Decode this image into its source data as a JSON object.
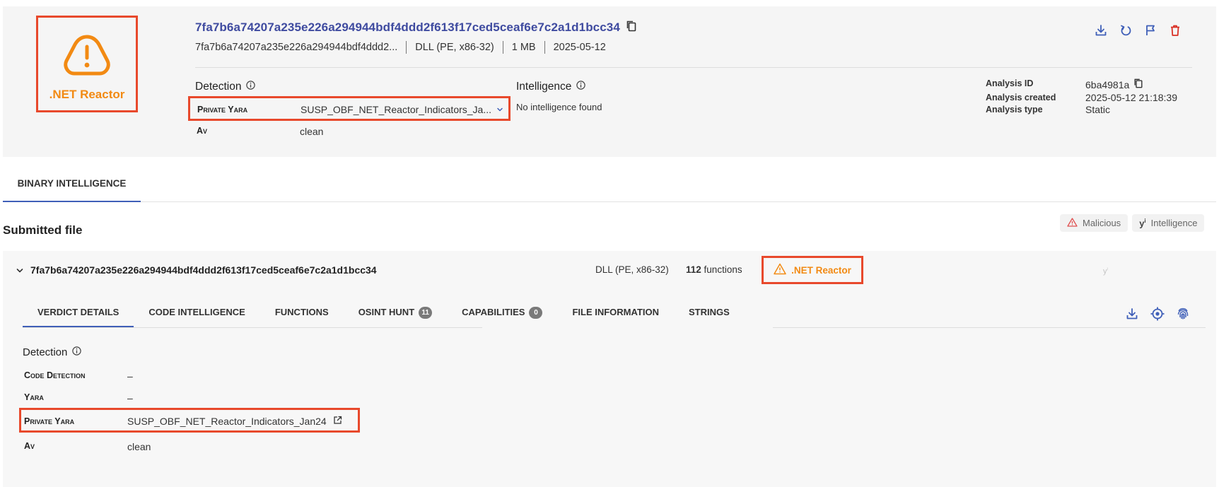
{
  "header": {
    "verdict_label": ".NET Reactor",
    "sha256": "7fa7b6a74207a235e226a294944bdf4ddd2f613f17ced5ceaf6e7c2a1d1bcc34",
    "name_truncated": "7fa7b6a74207a235e226a294944bdf4ddd2...",
    "file_type": "DLL (PE, x86-32)",
    "size": "1 MB",
    "date": "2025-05-12",
    "action_icons": [
      "download-icon",
      "refresh-icon",
      "flag-icon",
      "delete-icon"
    ]
  },
  "detection": {
    "heading": "Detection",
    "private_yara_label": "Private Yara",
    "private_yara_value": "SUSP_OBF_NET_Reactor_Indicators_Ja...",
    "av_label": "Av",
    "av_value": "clean"
  },
  "intelligence": {
    "heading": "Intelligence",
    "value": "No intelligence found"
  },
  "analysis": {
    "id_label": "Analysis ID",
    "id_value": "6ba4981a",
    "created_label": "Analysis created",
    "created_value": "2025-05-12 21:18:39",
    "type_label": "Analysis type",
    "type_value": "Static"
  },
  "main_tab": {
    "label": "BINARY INTELLIGENCE"
  },
  "submitted": {
    "heading": "Submitted file",
    "badges": [
      {
        "label": "Malicious",
        "icon": "warning-icon"
      },
      {
        "label": "Intelligence",
        "icon": "intelligence-icon"
      }
    ]
  },
  "file": {
    "hash": "7fa7b6a74207a235e226a294944bdf4ddd2f613f17ced5ceaf6e7c2a1d1bcc34",
    "type": "DLL (PE, x86-32)",
    "functions_count": "112",
    "functions_label": "functions",
    "verdict_label": ".NET Reactor",
    "tabs": [
      {
        "label": "VERDICT DETAILS",
        "active": true
      },
      {
        "label": "CODE INTELLIGENCE"
      },
      {
        "label": "FUNCTIONS"
      },
      {
        "label": "OSINT HUNT",
        "count": "11"
      },
      {
        "label": "CAPABILITIES",
        "count": "0"
      },
      {
        "label": "FILE INFORMATION"
      },
      {
        "label": "STRINGS"
      }
    ],
    "action_icons": [
      "download-icon",
      "target-icon",
      "fingerprint-icon"
    ]
  },
  "verdict_details": {
    "heading": "Detection",
    "code_detection_label": "Code Detection",
    "code_detection_value": "–",
    "yara_label": "Yara",
    "yara_value": "–",
    "private_yara_label": "Private Yara",
    "private_yara_value": "SUSP_OBF_NET_Reactor_Indicators_Jan24",
    "av_label": "Av",
    "av_value": "clean"
  },
  "colors": {
    "accent_blue": "#3f5fb8",
    "title_blue": "#3f4ba0",
    "warning_orange": "#f28a13",
    "highlight_red": "#e8492c",
    "delete_red": "#d93025"
  }
}
